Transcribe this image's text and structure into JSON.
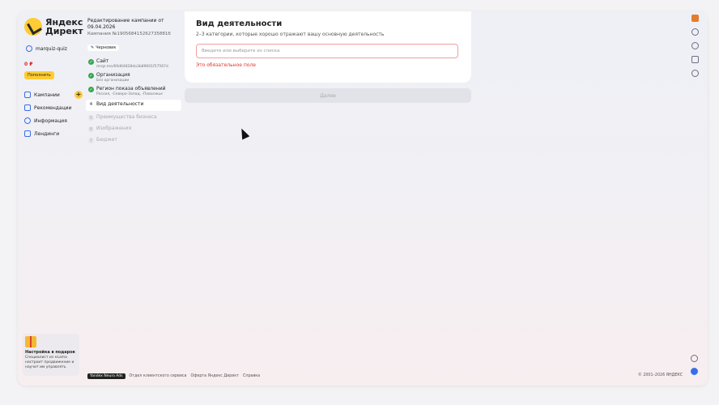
{
  "brand": {
    "name": "Яндекс Директ"
  },
  "user": {
    "login": "marquiz-quiz"
  },
  "account": {
    "balance": "0 ₽",
    "topup_label": "Пополнить"
  },
  "nav": [
    {
      "label": "Кампании",
      "icon": "campaigns-icon"
    },
    {
      "label": "Рекомендации",
      "icon": "lightning-icon"
    },
    {
      "label": "Информация",
      "icon": "info-icon"
    },
    {
      "label": "Лендинги",
      "icon": "landing-icon"
    }
  ],
  "promo": {
    "title": "Настройка в подарок",
    "text": "Специалист из eLama настроит продвижение и научит им управлять"
  },
  "campaign": {
    "title": "Редактирование кампании от 09.04.2026",
    "number": "Кампания №190568415262735881б",
    "status": "Черновик"
  },
  "steps": [
    {
      "label": "Сайт",
      "sub": "mrqz.me/69d64828da3b89001f57567d",
      "state": "done"
    },
    {
      "label": "Организация",
      "sub": "Без организации",
      "state": "done"
    },
    {
      "label": "Регион показа объявлений",
      "sub": "Россия, -Северо-Запад, -Поволжье",
      "state": "done"
    },
    {
      "label": "Вид деятельности",
      "number": "4",
      "state": "active"
    },
    {
      "label": "Преимущества бизнеса",
      "number": "5",
      "state": "todo"
    },
    {
      "label": "Изображения",
      "number": "6",
      "state": "todo"
    },
    {
      "label": "Бюджет",
      "number": "7",
      "state": "todo"
    }
  ],
  "activity": {
    "title": "Вид деятельности",
    "subtitle": "2–3 категории, которые хорошо отражают вашу основную деятельность",
    "placeholder": "Введите или выберите из списка",
    "error": "Это обязательное поле"
  },
  "next_label": "Далее",
  "footer": {
    "neuro": "Yandex Neuro Ads",
    "links": [
      "Отдел клиентского сервиса",
      "Оферта Яндекс Директ",
      "Справка"
    ],
    "copyright": "© 2001–2026 ЯНДЕКС"
  }
}
